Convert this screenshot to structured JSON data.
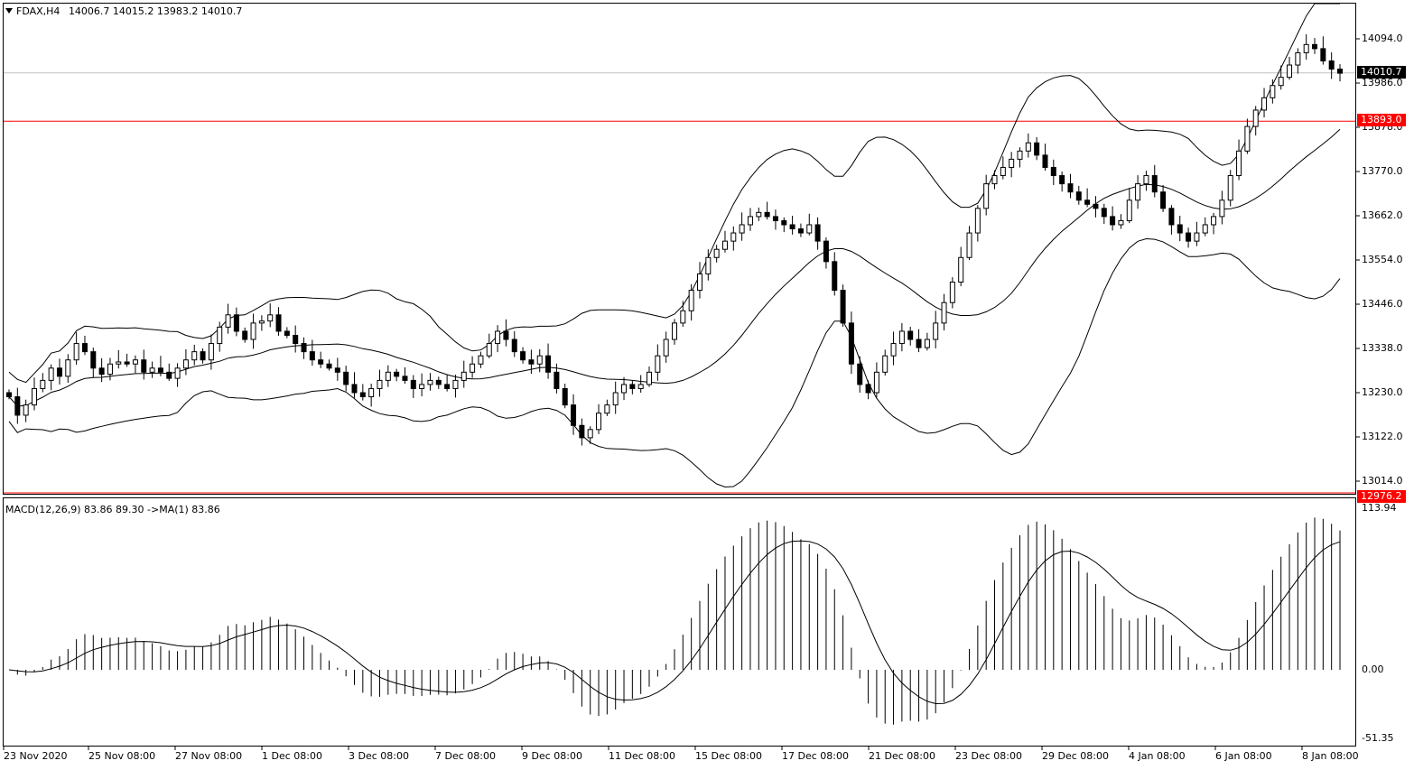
{
  "window": {
    "symbol": "FDAX,H4",
    "ohlc": "14006.7 14015.2 13983.2 14010.7"
  },
  "main_axis": {
    "ticks": [
      "14094.0",
      "13986.0",
      "13878.0",
      "13770.0",
      "13662.0",
      "13554.0",
      "13446.0",
      "13338.0",
      "13230.0",
      "13122.0",
      "13014.0"
    ],
    "price_tag": "14010.7",
    "level_tag": "13893.0",
    "low_tag": "12976.2"
  },
  "macd": {
    "label": "MACD(12,26,9) 83.86 89.30  ->MA(1) 83.86",
    "ticks": [
      "113.94",
      "0.00",
      "-51.35"
    ]
  },
  "time_axis": {
    "labels": [
      "23 Nov 2020",
      "25 Nov 08:00",
      "27 Nov 08:00",
      "1 Dec 08:00",
      "3 Dec 08:00",
      "7 Dec 08:00",
      "9 Dec 08:00",
      "11 Dec 08:00",
      "15 Dec 08:00",
      "17 Dec 08:00",
      "21 Dec 08:00",
      "23 Dec 08:00",
      "29 Dec 08:00",
      "4 Jan 08:00",
      "6 Jan 08:00",
      "8 Jan 08:00"
    ]
  },
  "colors": {
    "level_line": "#ff0000",
    "price_line": "#c0c0c0",
    "candle_up": "#ffffff",
    "candle_down": "#000000",
    "macd_hist": "#000000",
    "macd_signal": "#000000"
  },
  "chart_data": {
    "type": "candlestick",
    "title": "FDAX,H4",
    "ylim": [
      12976.2,
      14170
    ],
    "close_series": [
      13220,
      13175,
      13200,
      13240,
      13260,
      13290,
      13270,
      13310,
      13350,
      13330,
      13290,
      13275,
      13300,
      13305,
      13300,
      13310,
      13280,
      13290,
      13280,
      13265,
      13290,
      13310,
      13330,
      13310,
      13350,
      13390,
      13420,
      13380,
      13360,
      13400,
      13405,
      13420,
      13380,
      13370,
      13350,
      13330,
      13310,
      13300,
      13290,
      13280,
      13250,
      13230,
      13220,
      13240,
      13260,
      13280,
      13270,
      13260,
      13240,
      13250,
      13260,
      13250,
      13240,
      13260,
      13280,
      13300,
      13320,
      13350,
      13380,
      13360,
      13330,
      13310,
      13300,
      13320,
      13280,
      13240,
      13200,
      13150,
      13120,
      13140,
      13180,
      13200,
      13230,
      13250,
      13240,
      13250,
      13280,
      13320,
      13360,
      13400,
      13430,
      13480,
      13520,
      13560,
      13580,
      13600,
      13620,
      13640,
      13660,
      13670,
      13660,
      13650,
      13640,
      13630,
      13620,
      13640,
      13600,
      13550,
      13480,
      13400,
      13300,
      13250,
      13230,
      13280,
      13320,
      13350,
      13380,
      13360,
      13340,
      13360,
      13400,
      13450,
      13500,
      13560,
      13620,
      13680,
      13740,
      13760,
      13780,
      13800,
      13820,
      13840,
      13810,
      13780,
      13760,
      13740,
      13720,
      13700,
      13690,
      13680,
      13660,
      13640,
      13650,
      13700,
      13740,
      13760,
      13720,
      13680,
      13640,
      13620,
      13600,
      13620,
      13640,
      13660,
      13700,
      13760,
      13820,
      13880,
      13920,
      13950,
      13980,
      14000,
      14030,
      14060,
      14080,
      14070,
      14040,
      14020,
      14010
    ]
  }
}
